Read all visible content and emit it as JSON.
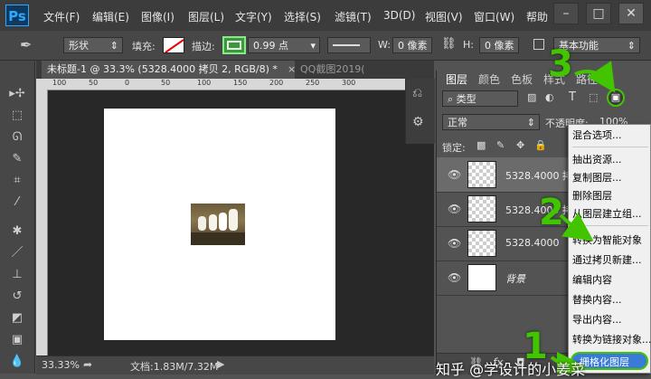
{
  "app": {
    "logo": "Ps"
  },
  "menu": [
    "文件(F)",
    "编辑(E)",
    "图像(I)",
    "图层(L)",
    "文字(Y)",
    "选择(S)",
    "滤镜(T)",
    "3D(D)",
    "视图(V)",
    "窗口(W)",
    "帮助"
  ],
  "window_buttons": {
    "minimize": "–",
    "maximize": "□",
    "close": "✕"
  },
  "options_bar": {
    "mode": "形状",
    "fill_label": "填充:",
    "stroke_label": "描边:",
    "stroke_width": "0.99 点",
    "w_label": "W:",
    "w_value": "0 像素",
    "h_label": "H:",
    "h_value": "0 像素",
    "workspace": "基本功能"
  },
  "document_tabs": [
    {
      "label": "未标题-1 @ 33.3% (5328.4000 拷贝 2, RGB/8) *",
      "close": "×"
    },
    {
      "label": "QQ截图2019(",
      "close": ""
    }
  ],
  "ruler_ticks": [
    "100",
    "50",
    "0",
    "50",
    "100",
    "150",
    "200",
    "250",
    "300"
  ],
  "status": {
    "zoom": "33.33%",
    "doc_info": "文档:1.83M/7.32M"
  },
  "layers_panel": {
    "tabs": [
      "图层",
      "颜色",
      "色板",
      "样式",
      "路径"
    ],
    "filter_type": "类型",
    "blend_mode": "正常",
    "opacity_label": "不透明度:",
    "opacity_value": "100%",
    "lock_label": "锁定:",
    "layers": [
      {
        "name": "5328.4000 拷贝",
        "kind": "smart"
      },
      {
        "name": "5328.4000 拷贝",
        "kind": "smart"
      },
      {
        "name": "5328.4000",
        "kind": "smart"
      },
      {
        "name": "背景",
        "kind": "background"
      }
    ]
  },
  "context_menu": {
    "items": [
      "混合选项...",
      "抽出资源...",
      "复制图层...",
      "删除图层",
      "从图层建立组...",
      "转换为智能对象",
      "通过拷贝新建...",
      "编辑内容",
      "替换内容...",
      "导出内容...",
      "转换为链接对象...",
      "栅格化图层"
    ],
    "highlighted": "栅格化图层"
  },
  "annotations": {
    "step1": "1",
    "step2": "2",
    "step3": "3",
    "color": "#43c400"
  },
  "watermark": "知乎 @学设计的小姜菜"
}
